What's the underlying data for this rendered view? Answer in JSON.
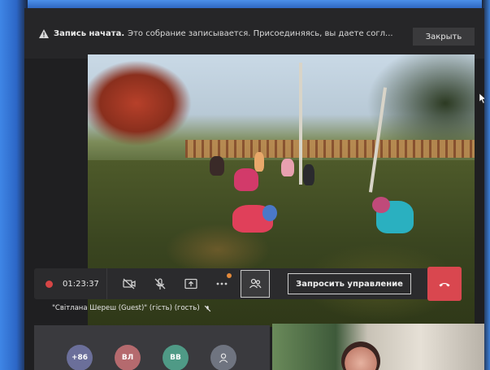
{
  "notice": {
    "title": "Запись начата.",
    "message": "Это собрание записывается. Присоединяясь, вы даете согл...",
    "close_label": "Закрыть"
  },
  "toolbar": {
    "timer": "01:23:37",
    "request_control_label": "Запросить управление"
  },
  "caption": {
    "participant": "\"Світлана Шереш (Guest)\" (гість) (гость)"
  },
  "gallery": {
    "avatars": [
      {
        "label": "+86",
        "color": "#6b6f9a"
      },
      {
        "label": "ВЛ",
        "color": "#b56a6e"
      },
      {
        "label": "ВВ",
        "color": "#4f9a86"
      },
      {
        "label": "",
        "color": "#6f7480"
      }
    ]
  },
  "icons": {
    "warning": "warning-icon",
    "camera_off": "camera-off-icon",
    "mic_off": "mic-off-icon",
    "share": "share-screen-icon",
    "more": "more-icon",
    "people": "people-icon",
    "hangup": "hangup-icon"
  },
  "colors": {
    "accent_record": "#d64545",
    "hangup": "#d9474f"
  }
}
